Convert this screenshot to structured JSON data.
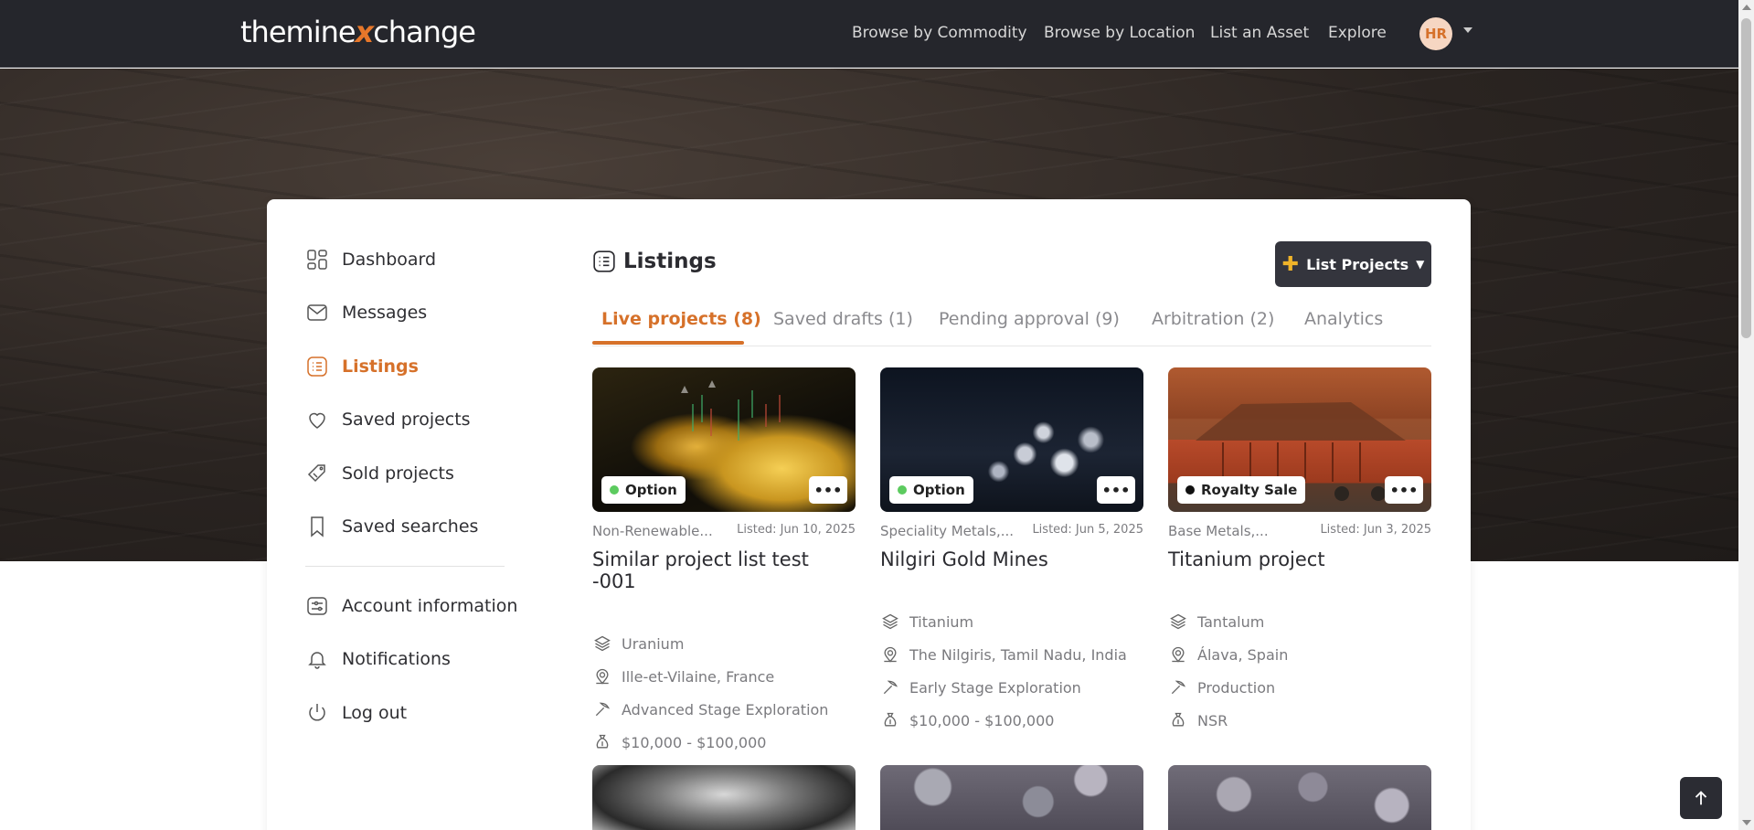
{
  "header": {
    "logo_left": "themine",
    "logo_x": "x",
    "logo_right": "change",
    "nav": [
      "Browse by Commodity",
      "Browse by Location",
      "List an Asset",
      "Explore"
    ],
    "avatar_initials": "HR"
  },
  "sidebar": {
    "items": [
      {
        "label": "Dashboard",
        "icon": "dashboard-icon"
      },
      {
        "label": "Messages",
        "icon": "mail-icon"
      },
      {
        "label": "Listings",
        "icon": "list-icon",
        "active": true
      },
      {
        "label": "Saved projects",
        "icon": "heart-icon"
      },
      {
        "label": "Sold projects",
        "icon": "tag-icon"
      },
      {
        "label": "Saved searches",
        "icon": "bookmark-icon"
      }
    ],
    "account_items": [
      {
        "label": "Account information",
        "icon": "settings-icon"
      },
      {
        "label": "Notifications",
        "icon": "bell-icon"
      },
      {
        "label": "Log out",
        "icon": "power-icon"
      }
    ]
  },
  "main": {
    "title": "Listings",
    "list_button": "List Projects",
    "tabs": [
      "Live projects (8)",
      "Saved drafts (1)",
      "Pending approval (9)",
      "Arbitration (2)",
      "Analytics"
    ],
    "active_tab": 0
  },
  "projects": [
    {
      "badge": "Option",
      "badge_color": "#5ccb5f",
      "category": "Non-Renewable...",
      "listed": "Listed: Jun 10, 2025",
      "name": "Similar project list test -001",
      "commodity": "Uranium",
      "location": "Ille-et-Vilaine, France",
      "stage": "Advanced Stage Exploration",
      "price": "$10,000 - $100,000"
    },
    {
      "badge": "Option",
      "badge_color": "#5ccb5f",
      "category": "Speciality Metals,...",
      "listed": "Listed: Jun 5, 2025",
      "name": "Nilgiri Gold Mines",
      "commodity": "Titanium",
      "location": "The Nilgiris, Tamil Nadu, India",
      "stage": "Early Stage Exploration",
      "price": "$10,000 - $100,000"
    },
    {
      "badge": "Royalty Sale",
      "badge_color": "#111111",
      "category": "Base Metals,...",
      "listed": "Listed: Jun 3, 2025",
      "name": "Titanium project",
      "commodity": "Tantalum",
      "location": "Álava, Spain",
      "stage": "Production",
      "price": "NSR"
    }
  ],
  "colors": {
    "accent": "#d6712a",
    "header_bg": "#25262c",
    "button_bg": "#34353d"
  }
}
